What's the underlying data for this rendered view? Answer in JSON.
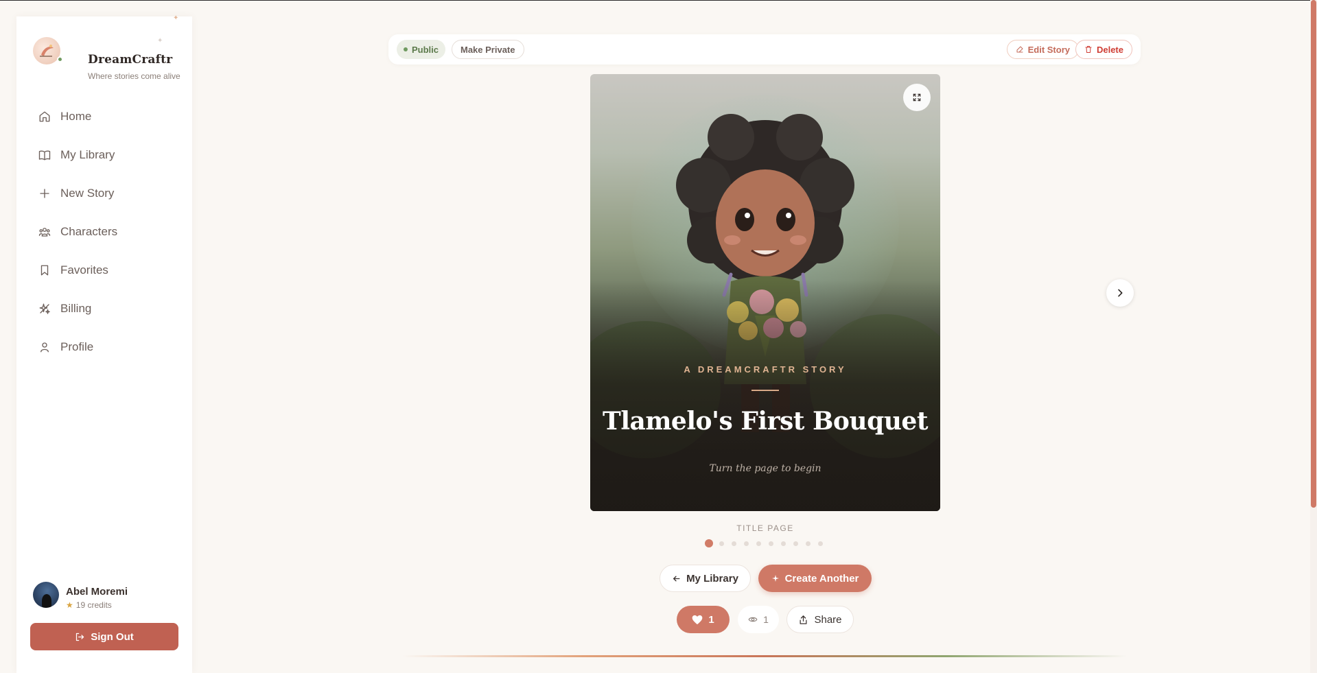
{
  "app": {
    "name": "DreamCraftr",
    "tagline": "Where stories come alive"
  },
  "sidebar": {
    "items": [
      {
        "label": "Home",
        "icon": "home-icon"
      },
      {
        "label": "My Library",
        "icon": "book-icon"
      },
      {
        "label": "New Story",
        "icon": "plus-icon"
      },
      {
        "label": "Characters",
        "icon": "users-icon"
      },
      {
        "label": "Favorites",
        "icon": "bookmark-icon"
      },
      {
        "label": "Billing",
        "icon": "sparkles-icon"
      },
      {
        "label": "Profile",
        "icon": "user-icon"
      }
    ],
    "user": {
      "name": "Abel Moremi",
      "credits": "19 credits"
    },
    "sign_out_label": "Sign Out"
  },
  "toolbar": {
    "visibility_label": "Public",
    "make_private_label": "Make Private",
    "edit_label": "Edit Story",
    "delete_label": "Delete"
  },
  "story": {
    "kicker": "A DREAMCRAFTR STORY",
    "title": "Tlamelo's First Bouquet",
    "subtitle": "Turn the page to begin",
    "page_label": "TITLE PAGE",
    "current_page": 1,
    "total_pages": 10
  },
  "actions": {
    "library_label": "My Library",
    "create_label": "Create Another",
    "likes": "1",
    "views": "1",
    "share_label": "Share"
  },
  "colors": {
    "accent": "#cf7966",
    "danger": "#cf3d34",
    "success": "#6f9a60",
    "background": "#faf7f3"
  }
}
